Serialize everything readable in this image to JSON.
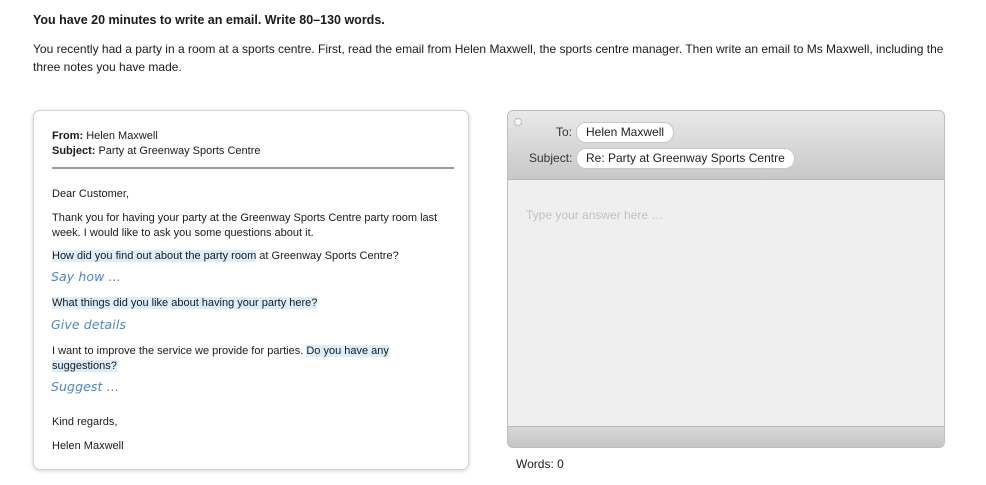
{
  "instructions": {
    "title": "You have 20 minutes to write an email. Write 80–130 words.",
    "body": "You recently had a party in a room at a sports centre. First, read the email from Helen Maxwell, the sports centre manager. Then write an email to Ms Maxwell, including the three notes you have made."
  },
  "email": {
    "from_label": "From:",
    "from": "Helen Maxwell",
    "subject_label": "Subject:",
    "subject": "Party at Greenway Sports Centre",
    "greeting": "Dear Customer,",
    "para1": "Thank you for having your party at the Greenway Sports Centre party room last week. I would like to ask you some questions about it.",
    "q1_highlight": "How did you find out about the party room",
    "q1_rest": " at Greenway Sports Centre?",
    "note1": "Say how …",
    "q2_highlight": "What things did you like about having your party here?",
    "note2": "Give details",
    "q3_plain": "I want to improve the service we provide for parties. ",
    "q3_highlight": "Do you have any suggestions?",
    "note3": "Suggest …",
    "signoff": "Kind regards,",
    "signature": "Helen Maxwell"
  },
  "reply": {
    "to_label": "To:",
    "to": "Helen Maxwell",
    "subject_label": "Subject:",
    "subject": "Re: Party at Greenway Sports Centre",
    "placeholder": "Type your answer here …",
    "value": ""
  },
  "word_count": {
    "label": "Words:",
    "count": "0"
  }
}
